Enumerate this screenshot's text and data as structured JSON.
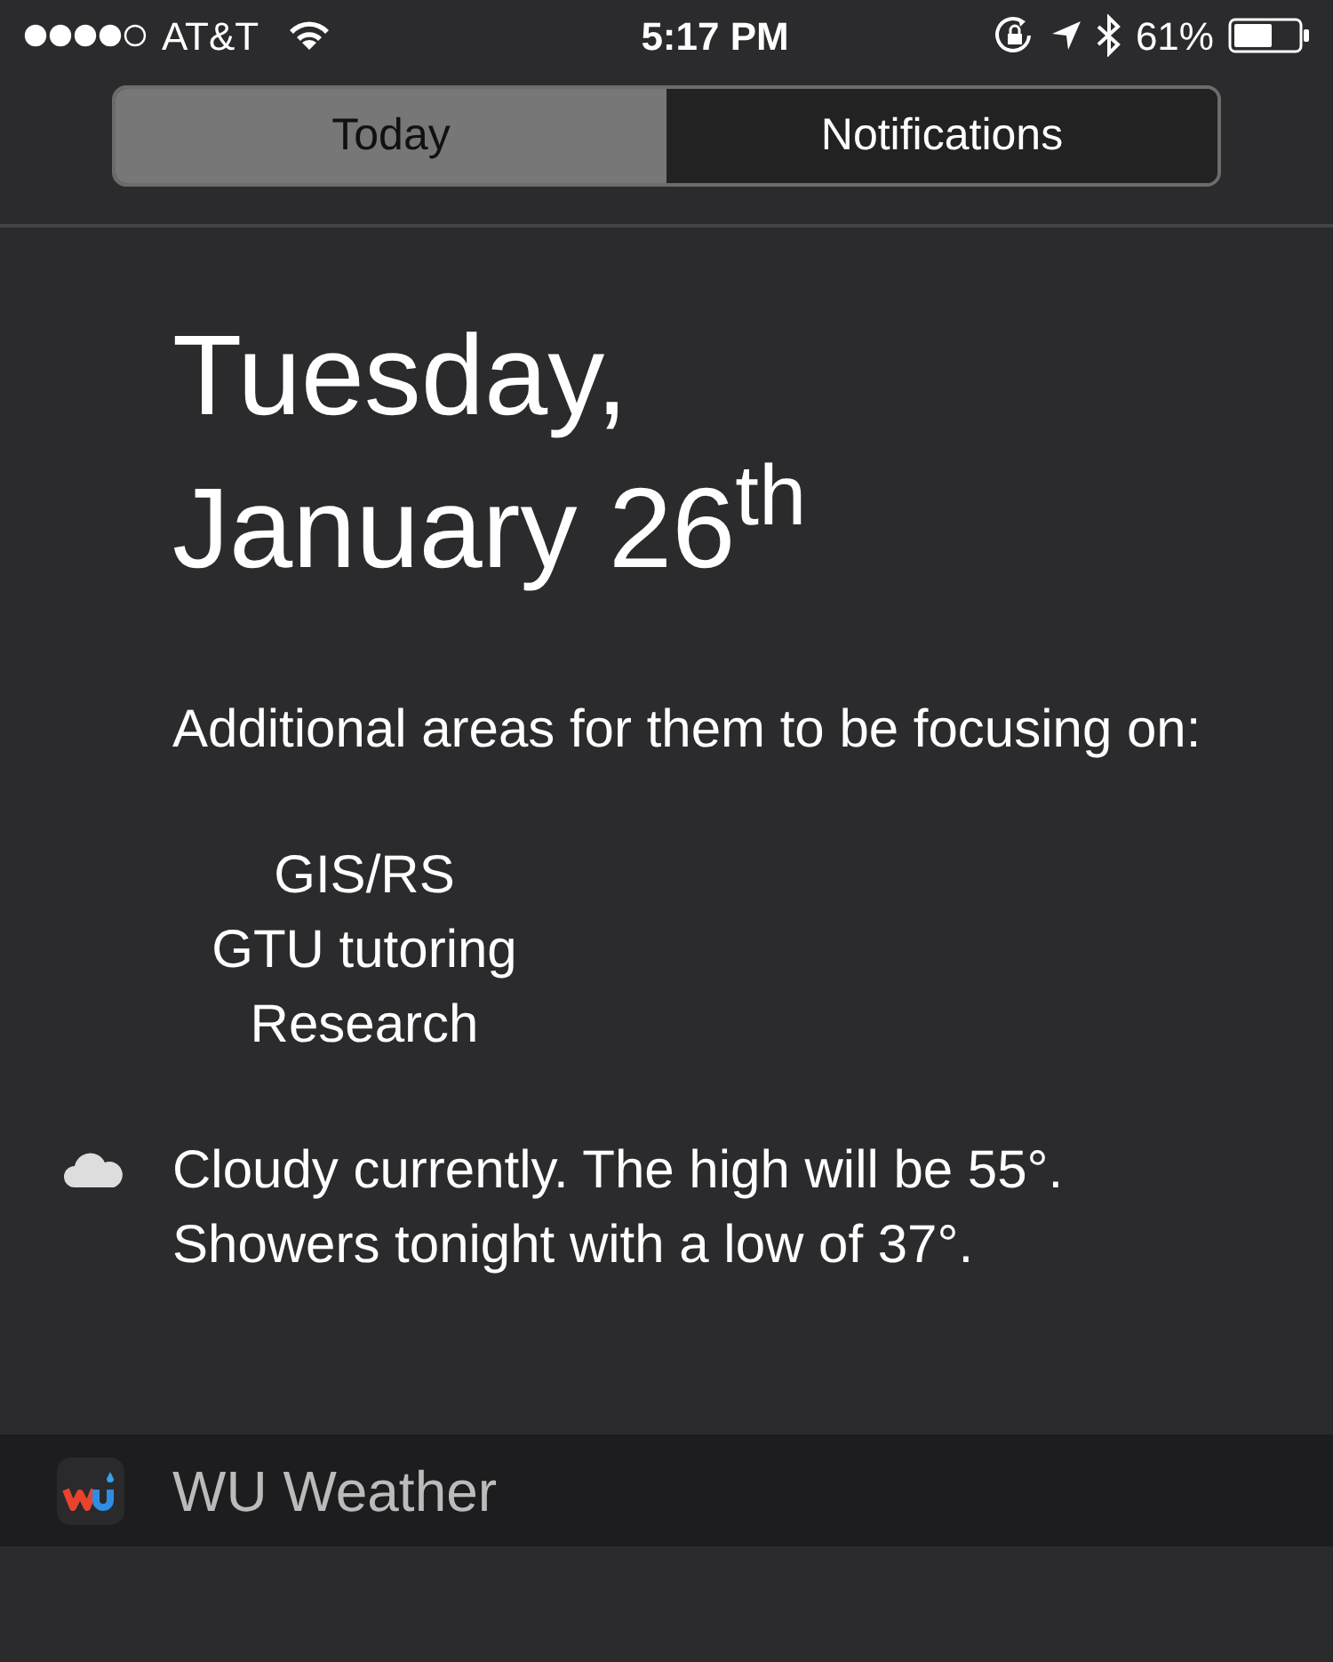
{
  "status_bar": {
    "carrier": "AT&T",
    "time": "5:17 PM",
    "battery": "61%"
  },
  "tabs": [
    {
      "label": "Today",
      "selected": true
    },
    {
      "label": "Notifications",
      "selected": false
    }
  ],
  "date": {
    "line_1": "Tuesday,",
    "line_2": "January 26$^{th}$"
  },
  "note": {
    "text": "Additional areas for them to be focusing on:",
    "items": [
      "GIS/RS",
      "GTU tutoring",
      "Research"
    ]
  },
  "weather": {
    "lines": [
      "Cloudy currently. The high will be 55°.",
      "Showers tonight with a low of 37°."
    ]
  },
  "widget": {
    "name": "WU Weather"
  }
}
